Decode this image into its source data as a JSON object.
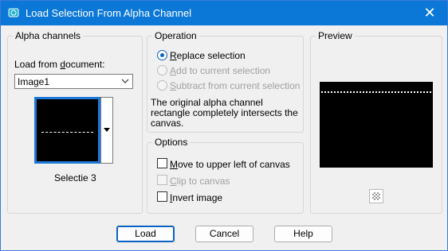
{
  "window": {
    "title": "Load Selection From Alpha Channel"
  },
  "alpha_channels": {
    "legend": "Alpha channels",
    "load_from_label": "Load from document:",
    "document_value": "Image1",
    "channel_name": "Selectie 3"
  },
  "operation": {
    "legend": "Operation",
    "options": [
      {
        "label": "Replace selection",
        "checked": true,
        "enabled": true
      },
      {
        "label": "Add to current selection",
        "checked": false,
        "enabled": false
      },
      {
        "label": "Subtract from current selection",
        "checked": false,
        "enabled": false
      }
    ],
    "info_line1": "The original alpha channel",
    "info_line2": "rectangle completely intersects the",
    "info_line3": "canvas."
  },
  "options": {
    "legend": "Options",
    "move_to_upper_left": "Move to upper left of canvas",
    "clip_to_canvas": "Clip to canvas",
    "invert_image": "Invert image"
  },
  "preview": {
    "legend": "Preview"
  },
  "buttons": {
    "load": "Load",
    "cancel": "Cancel",
    "help": "Help"
  },
  "colors": {
    "title_bar": "#0b78d7",
    "accent": "#0b62c4",
    "preview_bg": "#000000"
  },
  "icons": {
    "app": "selection-icon",
    "close": "close-icon",
    "dropdown": "chevron-down-icon",
    "transparency": "checkerboard-icon"
  }
}
